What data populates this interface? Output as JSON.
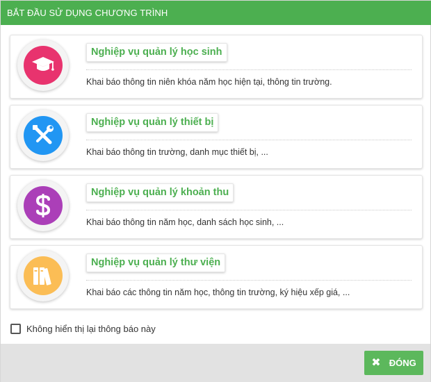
{
  "window": {
    "title": "BẮT ĐẦU SỬ DỤNG CHƯƠNG TRÌNH"
  },
  "modules": [
    {
      "title": "Nghiệp vụ quản lý học sinh",
      "description": "Khai báo thông tin niên khóa năm học hiện tại, thông tin trường.",
      "icon": "graduation-cap-icon",
      "color": "#e8336e"
    },
    {
      "title": "Nghiệp vụ quản lý thiết bị",
      "description": "Khai báo thông tin trường, danh mục thiết bị, ...",
      "icon": "tools-icon",
      "color": "#2196f3"
    },
    {
      "title": "Nghiệp vụ quản lý khoản thu",
      "description": "Khai báo thông tin năm học, danh sách học sinh, ...",
      "icon": "dollar-icon",
      "color": "#ab3fb8"
    },
    {
      "title": "Nghiệp vụ quản lý thư viện",
      "description": "Khai báo các thông tin năm học, thông tin trường, ký hiệu xếp giá, ...",
      "icon": "books-icon",
      "color": "#fbbd55"
    }
  ],
  "dont_show_again": {
    "label": "Không hiển thị lại thông báo này",
    "checked": false
  },
  "footer": {
    "close_label": "ĐÓNG",
    "close_icon": "close-icon"
  },
  "colors": {
    "header": "#4caf50",
    "accent_text": "#4caf50",
    "button": "#5cb85c",
    "footer_bg": "#e2e2e2"
  }
}
